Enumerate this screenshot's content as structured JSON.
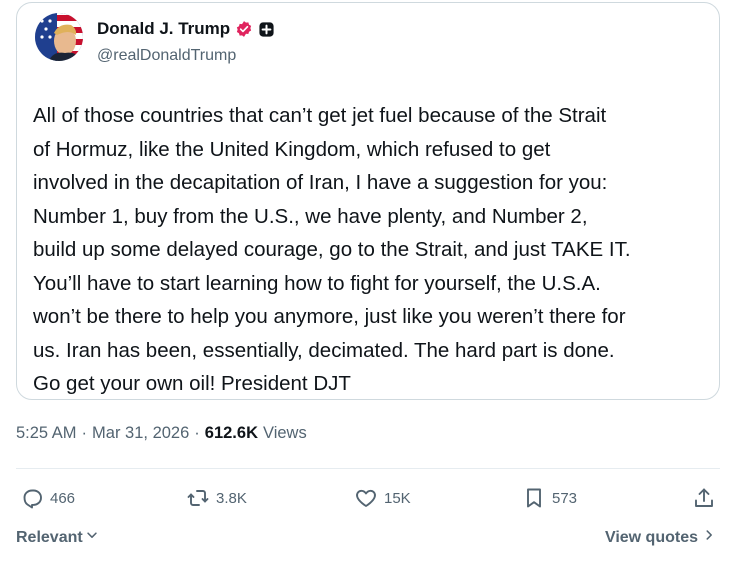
{
  "post": {
    "display_name": "Donald J. Trump",
    "handle": "@realDonaldTrump",
    "avatar_icon": "flag-portrait-avatar",
    "verified_icon": "verified-badge-icon",
    "affiliate_icon": "affiliate-badge-icon",
    "verified_color": "#e0245e",
    "body": "All of those countries that can’t get jet fuel because of the Strait\nof Hormuz, like the United Kingdom, which refused to get\ninvolved in the decapitation of Iran, I have a suggestion for you:\nNumber 1, buy from the U.S., we have plenty, and Number 2,\nbuild up some delayed courage, go to the Strait, and just TAKE IT.\nYou’ll have to start learning how to fight for yourself, the U.S.A.\nwon’t be there to help you anymore, just like you weren’t there for\nus. Iran has been, essentially, decimated. The hard part is done.\nGo get your own oil! President DJT"
  },
  "meta": {
    "time": "5:25 AM",
    "dot1": "·",
    "date": "Mar 31, 2026",
    "dot2": "·",
    "views": "612.6K",
    "views_label": "Views"
  },
  "actions": {
    "reply": {
      "icon": "reply-icon",
      "count": "466"
    },
    "repost": {
      "icon": "repost-icon",
      "count": "3.8K"
    },
    "like": {
      "icon": "heart-icon",
      "count": "15K"
    },
    "bookmark": {
      "icon": "bookmark-icon",
      "count": "573"
    },
    "share": {
      "icon": "share-icon"
    }
  },
  "footer": {
    "sort_label": "Relevant",
    "view_quotes_label": "View quotes"
  }
}
